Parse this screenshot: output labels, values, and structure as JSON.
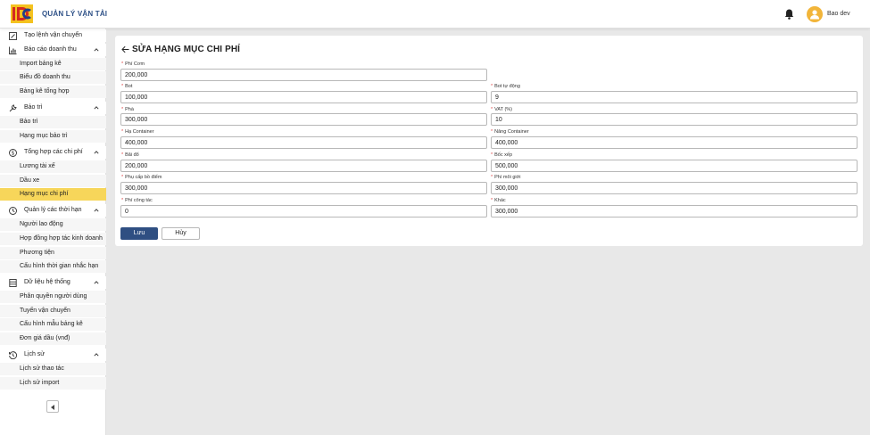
{
  "header": {
    "app_title": "QUẢN LÝ VẬN TẢI",
    "logo_icon": "company-logo",
    "notification_icon": "bell-icon",
    "user_name": "Bao dev"
  },
  "sidebar": {
    "groups": [
      {
        "label": "Tạo lệnh vận chuyển",
        "icon": "edit-square-icon",
        "expandable": false,
        "items": []
      },
      {
        "label": "Báo cáo doanh thu",
        "icon": "bar-chart-icon",
        "expandable": true,
        "items": [
          "Import bảng kê",
          "Biểu đồ doanh thu",
          "Bảng kê tổng hợp"
        ]
      },
      {
        "label": "Bảo trì",
        "icon": "wrench-icon",
        "expandable": true,
        "items": [
          "Bảo trì",
          "Hạng mục bảo trì"
        ]
      },
      {
        "label": "Tổng hợp các chi phí",
        "icon": "dollar-circle-icon",
        "expandable": true,
        "items": [
          "Lương tài xế",
          "Dầu xe",
          "Hạng mục chi phí"
        ]
      },
      {
        "label": "Quản lý các thời hạn",
        "icon": "clock-icon",
        "expandable": true,
        "items": [
          "Người lao động",
          "Hợp đồng hợp tác kinh doanh",
          "Phương tiện",
          "Cấu hình thời gian nhắc hạn"
        ]
      },
      {
        "label": "Dữ liệu hệ thống",
        "icon": "database-icon",
        "expandable": true,
        "items": [
          "Phân quyền người dùng",
          "Tuyến vận chuyển",
          "Cấu hình mẫu bảng kê",
          "Đơn giá dầu (vnđ)"
        ]
      },
      {
        "label": "Lịch sử",
        "icon": "history-icon",
        "expandable": true,
        "items": [
          "Lịch sử thao tác",
          "Lịch sử import"
        ]
      }
    ],
    "active_item": "Hạng mục chi phí"
  },
  "form": {
    "title": "SỬA HẠNG MỤC CHI PHÍ",
    "fields": [
      {
        "label": "Phí Cơm",
        "value": "200,000",
        "required": true
      },
      {
        "label": "Bot",
        "value": "100,000",
        "required": true
      },
      {
        "label": "Bot tự động",
        "value": "9",
        "required": true
      },
      {
        "label": "Phà",
        "value": "300,000",
        "required": true
      },
      {
        "label": "VAT (%)",
        "value": "10",
        "required": true
      },
      {
        "label": "Hạ Container",
        "value": "400,000",
        "required": true
      },
      {
        "label": "Nâng Container",
        "value": "400,000",
        "required": true
      },
      {
        "label": "Bãi đổ",
        "value": "200,000",
        "required": true
      },
      {
        "label": "Bốc xếp",
        "value": "500,000",
        "required": true
      },
      {
        "label": "Phụ cấp bồ điểm",
        "value": "300,000",
        "required": true
      },
      {
        "label": "Phí môi giới",
        "value": "300,000",
        "required": true
      },
      {
        "label": "Phí công tác",
        "value": "0",
        "required": true
      },
      {
        "label": "Khác",
        "value": "300,000",
        "required": true
      }
    ],
    "save_label": "Lưu",
    "cancel_label": "Hủy"
  },
  "colors": {
    "accent": "#2f4f82",
    "active_bg": "#f7d65a",
    "required": "#e04848",
    "avatar": "#f2b53a"
  }
}
